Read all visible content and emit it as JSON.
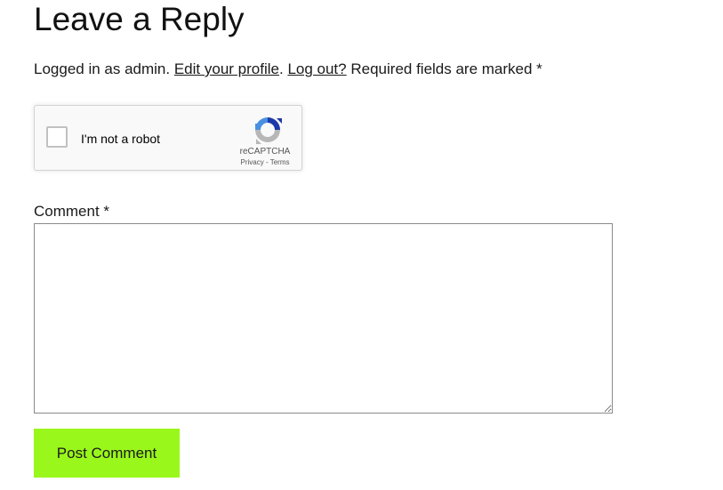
{
  "reply": {
    "heading": "Leave a Reply",
    "logged_in_prefix": "Logged in as admin.",
    "edit_profile_link": "Edit your profile",
    "separator": ".",
    "logout_link": "Log out?",
    "required_note": "Required fields are marked *"
  },
  "recaptcha": {
    "checkbox_label": "I'm not a robot",
    "brand": "reCAPTCHA",
    "privacy_link": "Privacy",
    "terms_separator": " - ",
    "terms_link": "Terms",
    "logo_icon": "recaptcha-logo-icon",
    "colors": {
      "blue": "#4a90e2",
      "dark_blue": "#1c3aa9",
      "gray": "#b7b7b7"
    }
  },
  "comment": {
    "label": "Comment *",
    "value": ""
  },
  "submit": {
    "label": "Post Comment",
    "color": "#9af71b"
  }
}
